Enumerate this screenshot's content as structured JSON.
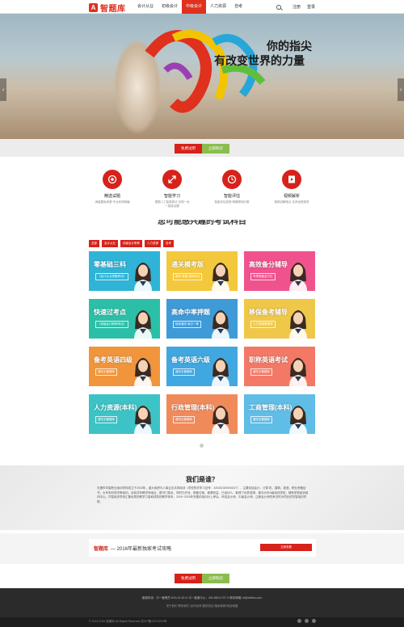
{
  "brand": {
    "name": "智题库",
    "mark": "A"
  },
  "nav": {
    "items": [
      {
        "label": "会计从业"
      },
      {
        "label": "初级会计"
      },
      {
        "label": "中级会计"
      },
      {
        "label": "人力资源"
      },
      {
        "label": "自考"
      }
    ],
    "active_index": 2
  },
  "header_right": {
    "login": "注册",
    "register": "登录"
  },
  "hero": {
    "line1": "你的指尖",
    "line2": "有改变世界的力量",
    "prev": "‹",
    "next": "›"
  },
  "cta": {
    "free_trial": "免费试用",
    "buy": "立即购买"
  },
  "features": [
    {
      "icon": "target-icon",
      "title": "精选试题",
      "desc": "海量题库资源 专业老师精编"
    },
    {
      "icon": "arrows-icon",
      "title": "智能学习",
      "desc": "根据人工智能算法 实现一对一智能出题"
    },
    {
      "icon": "clock-icon",
      "title": "智能评估",
      "desc": "智能评估成绩 精确预测分数"
    },
    {
      "icon": "video-icon",
      "title": "视频解析",
      "desc": "视频讲解难点 名师全程指导"
    }
  ],
  "section": {
    "title": "您可能感兴趣的考试科目"
  },
  "filters": [
    "全部",
    "会计从业",
    "初级会计职称",
    "人力资源",
    "自考"
  ],
  "cards": [
    {
      "title": "零基础三科",
      "sub": "《会计从业资格考试》",
      "color": "#2fb3d6"
    },
    {
      "title": "通关模考版",
      "sub": "模考·真题·模拟考试",
      "color": "#f3c83c"
    },
    {
      "title": "高效备分辅导",
      "sub": "专项突破全方位",
      "color": "#f0528d"
    },
    {
      "title": "快速过考点",
      "sub": "《初级会计职称考试》",
      "color": "#2cbfa7"
    },
    {
      "title": "高命中率押题",
      "sub": "轻松通关 每日一练",
      "color": "#3f9ad8"
    },
    {
      "title": "移保备考辅导",
      "sub": "人力资源管理师",
      "color": "#efc84a"
    },
    {
      "title": "备考英语四级",
      "sub": "通关必备题库",
      "color": "#f1953c"
    },
    {
      "title": "备考英语六级",
      "sub": "通关必备题库",
      "color": "#41a7e0"
    },
    {
      "title": "职称英语考试",
      "sub": "通关必备题库",
      "color": "#f37966"
    },
    {
      "title": "人力资源(本科)",
      "sub": "通关必备题库",
      "color": "#3dc3c6"
    },
    {
      "title": "行政管理(本科)",
      "sub": "通关必备题库",
      "color": "#f08a5a"
    },
    {
      "title": "工商管理(本科)",
      "sub": "通关必备题库",
      "color": "#5fbde6"
    }
  ],
  "who": {
    "title": "我们是谁？",
    "text": "无锡市华智职业培训学校成立于2003年，重大成绩与人事企业共同培训（学校的学学习证号：320202300000227），主要包括会计、计算 机、建筑、英语、职业资格证书、大专本科学历等培训，目前共有教学场地近，图书门类全，同时已开设，配套住宿，稳健效益，已培训人，取得了优异成绩，被评为市A级培训学校，拥有学校培训培训中心。华智培训学校汇集优秀的教学力量和成熟的教学体系，2016~2015年完善的培训分上岸后，科技会计师、中级会计师，注册会计师的考试时为同业的华智培训学院。"
  },
  "banner": {
    "brand": "智题库",
    "text": "— 2016年最新独家考试攻略",
    "button": "立即查看"
  },
  "footer": {
    "contact": "客服热线：中一管理员 8:00-21:00    ✆ 中一客服中心：400-8819-707    ✉ 联系邮箱: kf@zhitiku.com",
    "links": "关于我们   联系我们   合作伙伴   服务协议   隐私条款   网站地图",
    "copyright": "© 2014-2016 智题库 All Rights Reserved 苏ICP备13070204号"
  }
}
